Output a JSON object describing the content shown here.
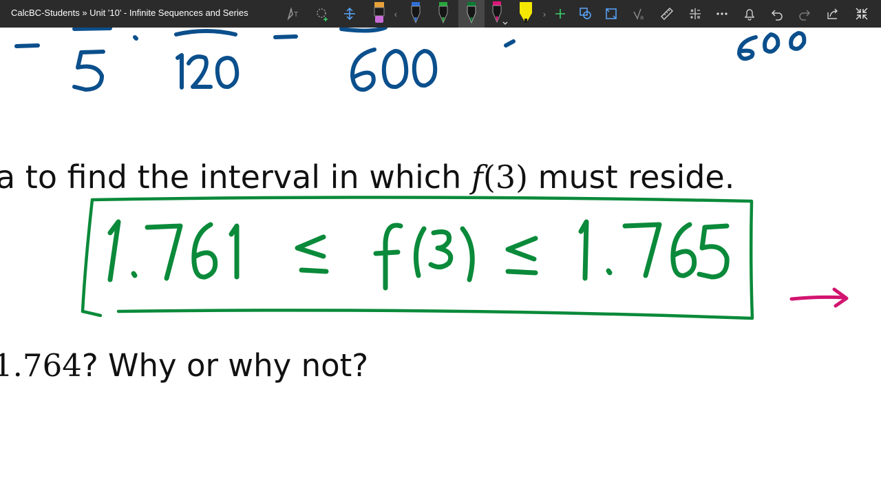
{
  "window": {
    "breadcrumb": "CalcBC-Students » Unit '10' - Infinite Sequences and Series"
  },
  "toolbar": {
    "tools": [
      {
        "name": "ink-to-text"
      },
      {
        "name": "lasso-select"
      },
      {
        "name": "add-space"
      }
    ],
    "pens": [
      {
        "name": "orange-purple-pen",
        "color": "#e8a13a",
        "tip": "#c86dd7"
      },
      {
        "name": "blue-pen",
        "color": "#2f6fd6"
      },
      {
        "name": "green-pen",
        "color": "#26a83a"
      },
      {
        "name": "dark-green-pen",
        "color": "#0c7a33",
        "selected": true
      },
      {
        "name": "magenta-pen",
        "color": "#e0157a"
      },
      {
        "name": "yellow-highlighter",
        "color": "#f5e800"
      }
    ],
    "actions": [
      {
        "name": "add-pen"
      },
      {
        "name": "shapes"
      },
      {
        "name": "ink-to-shape"
      },
      {
        "name": "ink-to-math"
      },
      {
        "name": "ruler"
      },
      {
        "name": "math-tools"
      },
      {
        "name": "more"
      },
      {
        "name": "notifications"
      },
      {
        "name": "undo"
      },
      {
        "name": "redo"
      },
      {
        "name": "share"
      },
      {
        "name": "exit-full-screen"
      }
    ]
  },
  "page": {
    "line1": {
      "before": "a to find the interval in which ",
      "math_f": "f",
      "math_arg": "(3)",
      "after": " must reside."
    },
    "line2": {
      "math_value": "1.764",
      "after": "? Why or why not?"
    }
  },
  "ink": {
    "colors": {
      "blue": "#0b4f8c",
      "green": "#0a8a3a",
      "magenta": "#d21470"
    },
    "top_fragments": [
      "5",
      "120",
      "600",
      "600"
    ],
    "boxed_inequality": [
      "1.761",
      "≤",
      "f(3)",
      "≤",
      "1.765"
    ]
  }
}
